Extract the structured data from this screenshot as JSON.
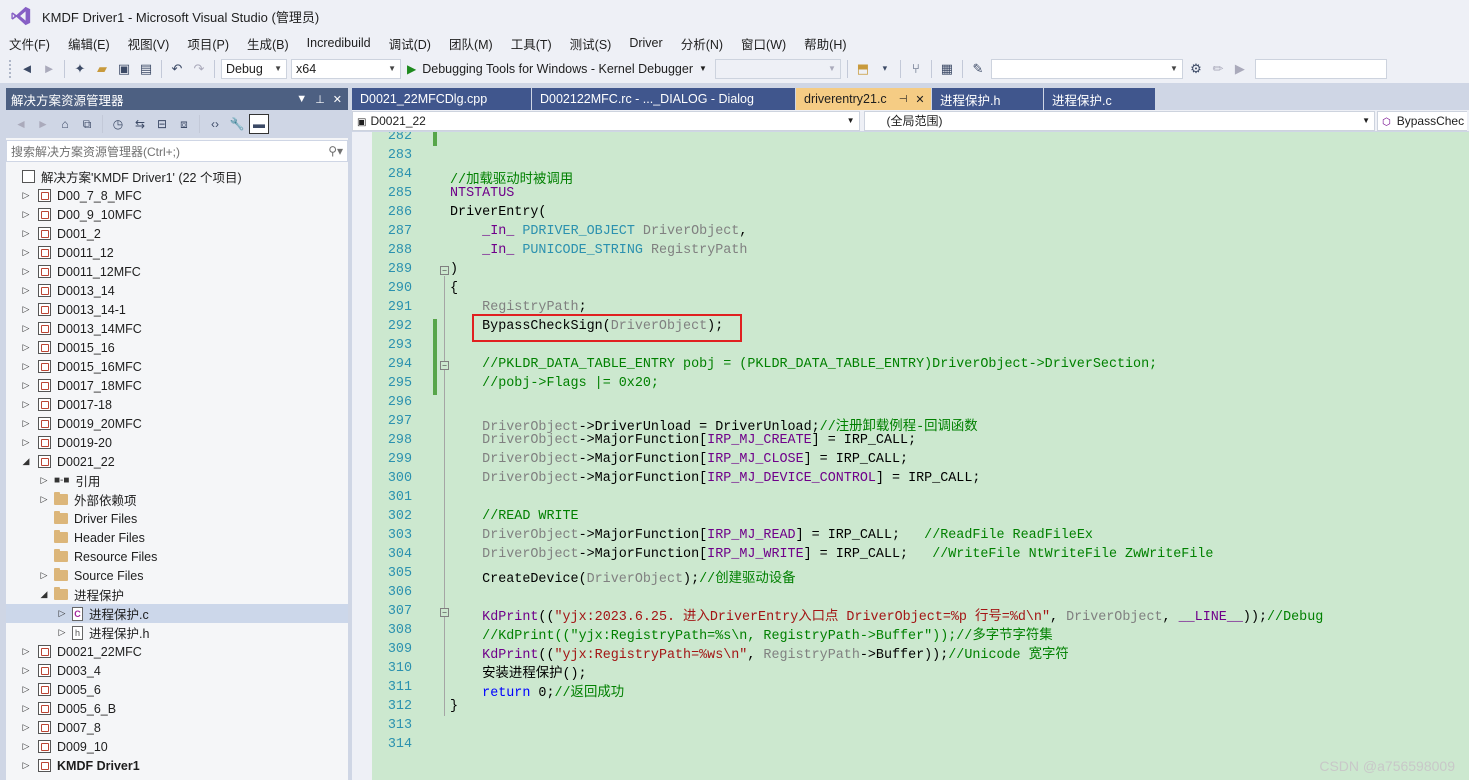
{
  "window": {
    "title": "KMDF Driver1 - Microsoft Visual Studio (管理员)"
  },
  "menu": [
    "文件(F)",
    "编辑(E)",
    "视图(V)",
    "项目(P)",
    "生成(B)",
    "Incredibuild",
    "调试(D)",
    "团队(M)",
    "工具(T)",
    "测试(S)",
    "Driver",
    "分析(N)",
    "窗口(W)",
    "帮助(H)"
  ],
  "toolbar": {
    "config": "Debug",
    "platform": "x64",
    "debugger": "Debugging Tools for Windows - Kernel Debugger"
  },
  "solution_explorer": {
    "title": "解决方案资源管理器",
    "search_placeholder": "搜索解决方案资源管理器(Ctrl+;)",
    "root": "解决方案'KMDF Driver1' (22 个项目)",
    "items": [
      {
        "label": "D00_7_8_MFC",
        "kind": "project",
        "expand": "collapsed",
        "indent": 0
      },
      {
        "label": "D00_9_10MFC",
        "kind": "project",
        "expand": "collapsed",
        "indent": 0
      },
      {
        "label": "D001_2",
        "kind": "project",
        "expand": "collapsed",
        "indent": 0
      },
      {
        "label": "D0011_12",
        "kind": "project",
        "expand": "collapsed",
        "indent": 0
      },
      {
        "label": "D0011_12MFC",
        "kind": "project",
        "expand": "collapsed",
        "indent": 0
      },
      {
        "label": "D0013_14",
        "kind": "project",
        "expand": "collapsed",
        "indent": 0
      },
      {
        "label": "D0013_14-1",
        "kind": "project",
        "expand": "collapsed",
        "indent": 0
      },
      {
        "label": "D0013_14MFC",
        "kind": "project",
        "expand": "collapsed",
        "indent": 0
      },
      {
        "label": "D0015_16",
        "kind": "project",
        "expand": "collapsed",
        "indent": 0
      },
      {
        "label": "D0015_16MFC",
        "kind": "project",
        "expand": "collapsed",
        "indent": 0
      },
      {
        "label": "D0017_18MFC",
        "kind": "project",
        "expand": "collapsed",
        "indent": 0
      },
      {
        "label": "D0017-18",
        "kind": "project",
        "expand": "collapsed",
        "indent": 0
      },
      {
        "label": "D0019_20MFC",
        "kind": "project",
        "expand": "collapsed",
        "indent": 0
      },
      {
        "label": "D0019-20",
        "kind": "project",
        "expand": "collapsed",
        "indent": 0
      },
      {
        "label": "D0021_22",
        "kind": "project",
        "expand": "expanded",
        "indent": 0
      },
      {
        "label": "引用",
        "kind": "ref",
        "expand": "collapsed",
        "indent": 1
      },
      {
        "label": "外部依赖项",
        "kind": "folder",
        "expand": "collapsed",
        "indent": 1
      },
      {
        "label": "Driver Files",
        "kind": "folder",
        "expand": "none",
        "indent": 1
      },
      {
        "label": "Header Files",
        "kind": "folder",
        "expand": "none",
        "indent": 1
      },
      {
        "label": "Resource Files",
        "kind": "folder",
        "expand": "none",
        "indent": 1
      },
      {
        "label": "Source Files",
        "kind": "folder",
        "expand": "collapsed",
        "indent": 1
      },
      {
        "label": "进程保护",
        "kind": "folder",
        "expand": "expanded",
        "indent": 1
      },
      {
        "label": "进程保护.c",
        "kind": "cfile",
        "expand": "collapsed",
        "indent": 2,
        "selected": true
      },
      {
        "label": "进程保护.h",
        "kind": "hfile",
        "expand": "collapsed",
        "indent": 2
      },
      {
        "label": "D0021_22MFC",
        "kind": "project",
        "expand": "collapsed",
        "indent": 0
      },
      {
        "label": "D003_4",
        "kind": "project",
        "expand": "collapsed",
        "indent": 0
      },
      {
        "label": "D005_6",
        "kind": "project",
        "expand": "collapsed",
        "indent": 0
      },
      {
        "label": "D005_6_B",
        "kind": "project",
        "expand": "collapsed",
        "indent": 0
      },
      {
        "label": "D007_8",
        "kind": "project",
        "expand": "collapsed",
        "indent": 0
      },
      {
        "label": "D009_10",
        "kind": "project",
        "expand": "collapsed",
        "indent": 0
      },
      {
        "label": "KMDF Driver1",
        "kind": "project",
        "expand": "collapsed",
        "indent": 0,
        "bold": true
      }
    ]
  },
  "tabs": [
    {
      "label": "D0021_22MFCDlg.cpp",
      "active": false
    },
    {
      "label": "D002122MFC.rc - ..._DIALOG - Dialog",
      "active": false
    },
    {
      "label": "driverentry21.c",
      "active": true
    },
    {
      "label": "进程保护.h",
      "active": false
    },
    {
      "label": "进程保护.c",
      "active": false
    }
  ],
  "navbar": {
    "project": "D0021_22",
    "scope": "(全局范围)",
    "member": "BypassChec"
  },
  "code": {
    "first_line": 282,
    "lines": [
      [],
      [],
      [
        [
          "c-com",
          "//加载驱动时被调用"
        ]
      ],
      [
        [
          "c-mac",
          "NTSTATUS"
        ]
      ],
      [
        [
          "c-fn",
          "DriverEntry("
        ]
      ],
      [
        [
          "",
          "    "
        ],
        [
          "c-mac",
          "_In_"
        ],
        [
          "",
          " "
        ],
        [
          "c-typ",
          "PDRIVER_OBJECT"
        ],
        [
          "",
          " "
        ],
        [
          "c-par",
          "DriverObject"
        ],
        [
          "",
          ","
        ]
      ],
      [
        [
          "",
          "    "
        ],
        [
          "c-mac",
          "_In_"
        ],
        [
          "",
          " "
        ],
        [
          "c-typ",
          "PUNICODE_STRING"
        ],
        [
          "",
          " "
        ],
        [
          "c-par",
          "RegistryPath"
        ]
      ],
      [
        [
          "",
          ")"
        ]
      ],
      [
        [
          "",
          "{"
        ]
      ],
      [
        [
          "",
          "    "
        ],
        [
          "c-par",
          "RegistryPath"
        ],
        [
          "",
          ";"
        ]
      ],
      [
        [
          "",
          "    BypassCheckSign("
        ],
        [
          "c-par",
          "DriverObject"
        ],
        [
          "",
          ");"
        ]
      ],
      [],
      [
        [
          "",
          "    "
        ],
        [
          "c-com",
          "//PKLDR_DATA_TABLE_ENTRY pobj = (PKLDR_DATA_TABLE_ENTRY)DriverObject->DriverSection;"
        ]
      ],
      [
        [
          "",
          "    "
        ],
        [
          "c-com",
          "//pobj->Flags |= 0x20;"
        ]
      ],
      [],
      [
        [
          "",
          "    "
        ],
        [
          "c-par",
          "DriverObject"
        ],
        [
          "",
          "->DriverUnload = DriverUnload;"
        ],
        [
          "c-com",
          "//注册卸载例程-回调函数"
        ]
      ],
      [
        [
          "",
          "    "
        ],
        [
          "c-par",
          "DriverObject"
        ],
        [
          "",
          "->MajorFunction["
        ],
        [
          "c-mac",
          "IRP_MJ_CREATE"
        ],
        [
          "",
          "] = IRP_CALL;"
        ]
      ],
      [
        [
          "",
          "    "
        ],
        [
          "c-par",
          "DriverObject"
        ],
        [
          "",
          "->MajorFunction["
        ],
        [
          "c-mac",
          "IRP_MJ_CLOSE"
        ],
        [
          "",
          "] = IRP_CALL;"
        ]
      ],
      [
        [
          "",
          "    "
        ],
        [
          "c-par",
          "DriverObject"
        ],
        [
          "",
          "->MajorFunction["
        ],
        [
          "c-mac",
          "IRP_MJ_DEVICE_CONTROL"
        ],
        [
          "",
          "] = IRP_CALL;"
        ]
      ],
      [],
      [
        [
          "",
          "    "
        ],
        [
          "c-com",
          "//READ WRITE"
        ]
      ],
      [
        [
          "",
          "    "
        ],
        [
          "c-par",
          "DriverObject"
        ],
        [
          "",
          "->MajorFunction["
        ],
        [
          "c-mac",
          "IRP_MJ_READ"
        ],
        [
          "",
          "] = IRP_CALL;   "
        ],
        [
          "c-com",
          "//ReadFile ReadFileEx"
        ]
      ],
      [
        [
          "",
          "    "
        ],
        [
          "c-par",
          "DriverObject"
        ],
        [
          "",
          "->MajorFunction["
        ],
        [
          "c-mac",
          "IRP_MJ_WRITE"
        ],
        [
          "",
          "] = IRP_CALL;   "
        ],
        [
          "c-com",
          "//WriteFile NtWriteFile ZwWriteFile"
        ]
      ],
      [
        [
          "",
          "    CreateDevice("
        ],
        [
          "c-par",
          "DriverObject"
        ],
        [
          "",
          ");"
        ],
        [
          "c-com",
          "//创建驱动设备"
        ]
      ],
      [],
      [
        [
          "",
          "    "
        ],
        [
          "c-mac",
          "KdPrint"
        ],
        [
          "",
          "(("
        ],
        [
          "c-str",
          "\"yjx:2023.6.25. 进入DriverEntry入口点 DriverObject=%p 行号=%d\\n\""
        ],
        [
          "",
          ", "
        ],
        [
          "c-par",
          "DriverObject"
        ],
        [
          "",
          ", "
        ],
        [
          "c-mac",
          "__LINE__"
        ],
        [
          "",
          "));"
        ],
        [
          "c-com",
          "//Debug"
        ]
      ],
      [
        [
          "",
          "    "
        ],
        [
          "c-com",
          "//KdPrint((\"yjx:RegistryPath=%s\\n, RegistryPath->Buffer\"));//多字节字符集"
        ]
      ],
      [
        [
          "",
          "    "
        ],
        [
          "c-mac",
          "KdPrint"
        ],
        [
          "",
          "(("
        ],
        [
          "c-str",
          "\"yjx:RegistryPath=%ws\\n\""
        ],
        [
          "",
          ", "
        ],
        [
          "c-par",
          "RegistryPath"
        ],
        [
          "",
          "->Buffer));"
        ],
        [
          "c-com",
          "//Unicode 宽字符"
        ]
      ],
      [
        [
          "",
          "    安装进程保护();"
        ]
      ],
      [
        [
          "",
          "    "
        ],
        [
          "c-kw",
          "return"
        ],
        [
          "",
          " 0;"
        ],
        [
          "c-com",
          "//返回成功"
        ]
      ],
      [
        [
          "",
          "}"
        ]
      ],
      [],
      []
    ]
  },
  "watermark": "CSDN @a756598009",
  "colors": {
    "editor_bg": "#cce8cf",
    "tab_active": "#f5cc84",
    "tab_inactive": "#40568d",
    "highlight": "#e02020"
  }
}
